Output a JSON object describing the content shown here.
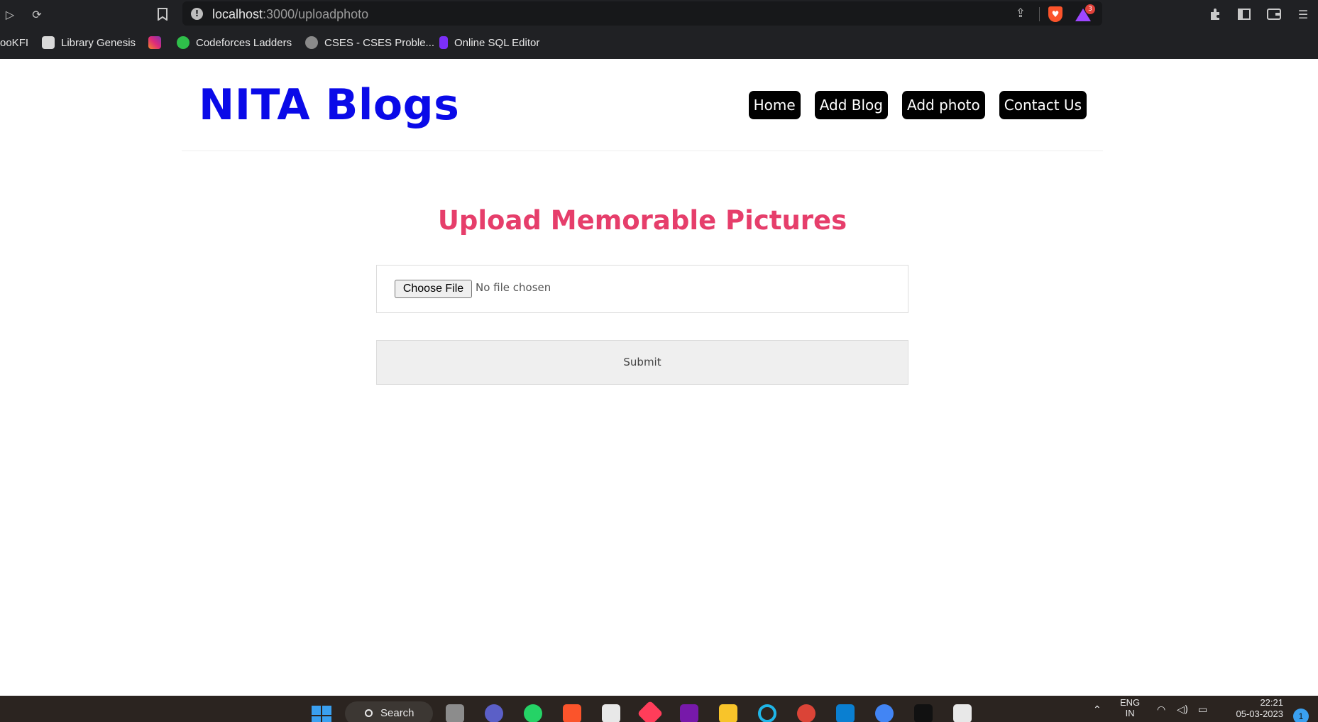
{
  "browser": {
    "url_host": "localhost",
    "url_path": ":3000/uploadphoto",
    "rewards_count": "3",
    "bookmarks": [
      {
        "label": "ooKFI",
        "color": "#202124"
      },
      {
        "label": "Library Genesis",
        "color": "#d9d9d9"
      },
      {
        "label": "",
        "color": "#d6249f"
      },
      {
        "label": "Codeforces Ladders",
        "color": "#2fbf4a"
      },
      {
        "label": "CSES - CSES Proble...",
        "color": "#8a8a8a"
      },
      {
        "label": "Online SQL Editor",
        "color": "#7b2ff7"
      }
    ]
  },
  "page": {
    "brand": "NITA Blogs",
    "nav": [
      "Home",
      "Add Blog",
      "Add photo",
      "Contact Us"
    ],
    "heading": "Upload Memorable Pictures",
    "choose_file": "Choose File",
    "no_file": "No file chosen",
    "submit": "Submit"
  },
  "taskbar": {
    "search": "Search",
    "lang": "ENG",
    "lang2": "IN",
    "time": "22:21",
    "date": "05-03-2023",
    "notifications": "1"
  },
  "colors": {
    "brand": "#0a0ae8",
    "heading": "#e63e6b",
    "nav_bg": "#000000",
    "chrome_bg": "#202124"
  }
}
